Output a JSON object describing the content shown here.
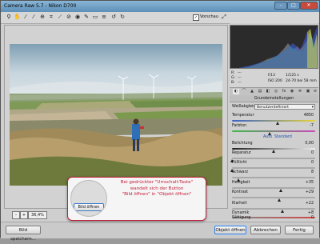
{
  "window": {
    "title": "Camera Raw 5.7 - Nikon D700",
    "controls": [
      "–",
      "□",
      "✕"
    ]
  },
  "toolbar": {
    "tools": [
      "zoom-icon",
      "hand-icon",
      "white-balance-icon",
      "color-sampler-icon",
      "target-adjust-icon",
      "crop-icon",
      "straighten-icon",
      "spot-removal-icon",
      "red-eye-icon",
      "adjustment-brush-icon",
      "graduated-filter-icon",
      "preferences-icon",
      "rotate-left-icon",
      "rotate-right-icon"
    ],
    "preview_label": "Vorschau",
    "preview_checked": true
  },
  "zoom": {
    "minus": "–",
    "plus": "+",
    "value": "36,4%"
  },
  "histogram": {
    "rgb": [
      {
        "label": "R:",
        "value": "---"
      },
      {
        "label": "G:",
        "value": "---"
      },
      {
        "label": "B:",
        "value": "---"
      }
    ],
    "aperture": "f/13",
    "shutter": "1/125 s",
    "iso": "ISO 200",
    "lens": "24-70 bei 58 mm"
  },
  "panel": {
    "title": "Grundeinstellungen",
    "white_balance_label": "Weißabgleich:",
    "white_balance_value": "Benutzerdefiniert",
    "auto_link": "Auto",
    "standard_link": "Standard",
    "controls": [
      {
        "label": "Temperatur",
        "value": "4850",
        "pos": 0.55
      },
      {
        "label": "Farbton",
        "value": "-7",
        "pos": 0.46
      },
      {
        "label": "Belichtung",
        "value": "0,00",
        "pos": 0.5
      },
      {
        "label": "Reparatur",
        "value": "0",
        "pos": 0.0
      },
      {
        "label": "Fülllicht",
        "value": "0",
        "pos": 0.0
      },
      {
        "label": "Schwarz",
        "value": "8",
        "pos": 0.08
      },
      {
        "label": "Helligkeit",
        "value": "+35",
        "pos": 0.59
      },
      {
        "label": "Kontrast",
        "value": "+29",
        "pos": 0.57
      },
      {
        "label": "Klarheit",
        "value": "+22",
        "pos": 0.61
      },
      {
        "label": "Dynamik",
        "value": "+8",
        "pos": 0.54
      },
      {
        "label": "Sättigung",
        "value": "0",
        "pos": 0.5
      }
    ]
  },
  "buttons": {
    "save": "Bild speichern...",
    "open_object": "Objekt öffnen",
    "cancel": "Abbrechen",
    "done": "Fertig"
  },
  "callout": {
    "button_label": "Bild öffnen",
    "line1": "Bei gedrückter \"Umschalt-Taste\"",
    "line2": "wandelt sich der Button",
    "line3": "\"Bild öffnen\" in \"Objekt öffnen\""
  }
}
